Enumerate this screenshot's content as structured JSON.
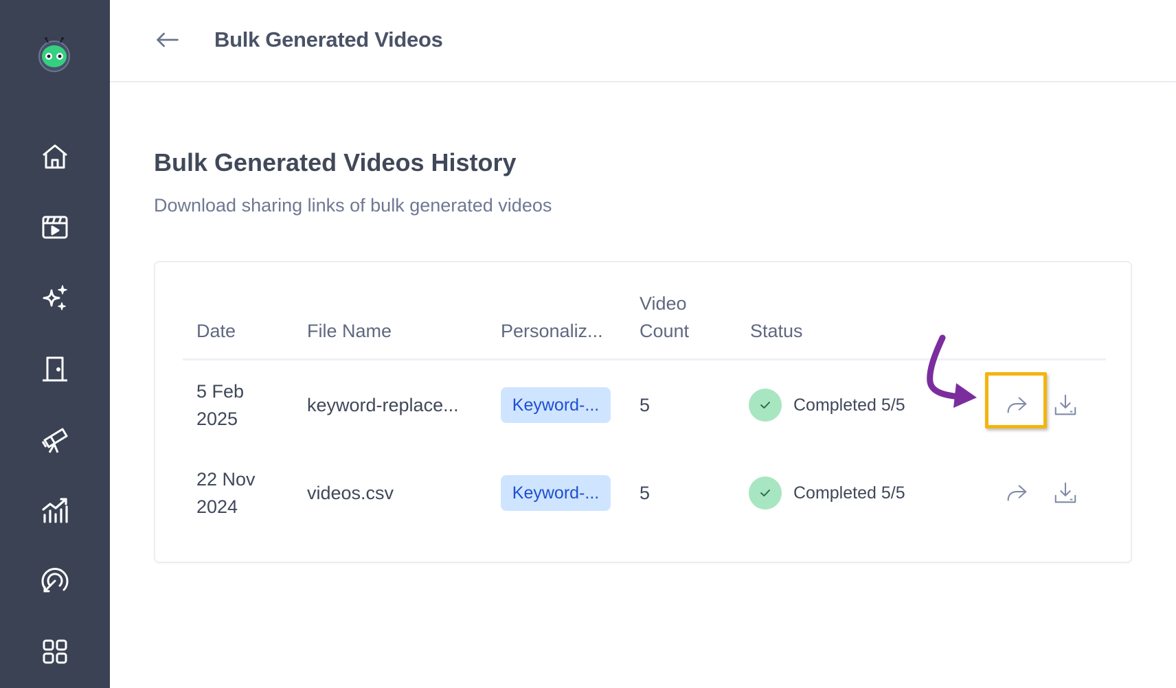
{
  "app": {
    "logo_icon": "robot-logo-icon",
    "accent_color": "#3a4253"
  },
  "sidebar": {
    "items": [
      {
        "name": "home",
        "icon": "home-icon"
      },
      {
        "name": "videos",
        "icon": "clapperboard-icon"
      },
      {
        "name": "ai",
        "icon": "sparkles-icon"
      },
      {
        "name": "rooms",
        "icon": "door-icon"
      },
      {
        "name": "discover",
        "icon": "telescope-icon"
      },
      {
        "name": "analytics",
        "icon": "analytics-icon"
      },
      {
        "name": "engagement",
        "icon": "target-icon"
      },
      {
        "name": "apps",
        "icon": "grid-icon"
      }
    ]
  },
  "header": {
    "back_icon": "arrow-left-icon",
    "title": "Bulk Generated Videos"
  },
  "main": {
    "title": "Bulk Generated Videos History",
    "subtitle": "Download sharing links of bulk generated videos"
  },
  "table": {
    "columns": {
      "date": "Date",
      "file_name": "File Name",
      "personalization": "Personaliz...",
      "video_count_line1": "Video",
      "video_count_line2": "Count",
      "status": "Status"
    },
    "rows": [
      {
        "date_line1": "5 Feb",
        "date_line2": "2025",
        "file_name": "keyword-replace...",
        "personalization": "Keyword-...",
        "video_count": "5",
        "status": "Completed 5/5",
        "highlighted": true
      },
      {
        "date_line1": "22 Nov",
        "date_line2": "2024",
        "file_name": "videos.csv",
        "personalization": "Keyword-...",
        "video_count": "5",
        "status": "Completed 5/5",
        "highlighted": false
      }
    ]
  },
  "colors": {
    "badge_bg": "#cfe4ff",
    "badge_text": "#1e4fd0",
    "status_success": "#a8e6c1",
    "highlight": "#f5b50f",
    "annotation_arrow": "#7b2d9e"
  }
}
